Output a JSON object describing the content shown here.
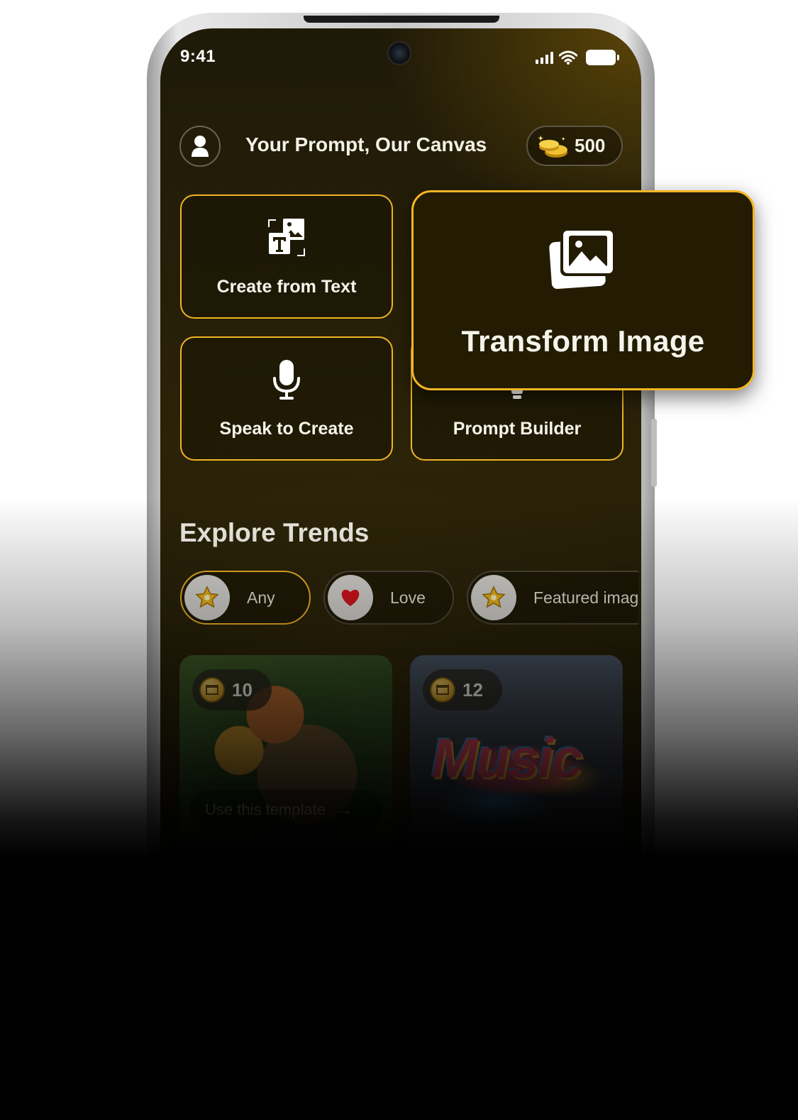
{
  "status_bar": {
    "time": "9:41"
  },
  "header": {
    "title": "Your Prompt, Our Canvas",
    "coins": "500"
  },
  "actions": {
    "create_from_text": "Create from Text",
    "transform_image": "Transform Image",
    "speak_to_create": "Speak to Create",
    "prompt_builder": "Prompt Builder"
  },
  "explore": {
    "title": "Explore Trends",
    "chips": [
      {
        "label": "Any",
        "icon": "star-badge-icon",
        "active": true
      },
      {
        "label": "Love",
        "icon": "heart-icon",
        "active": false
      },
      {
        "label": "Featured image",
        "icon": "star-badge-icon",
        "active": false
      }
    ],
    "templates": [
      {
        "cost": "10",
        "image": "jungle-cartoon-animals",
        "action": "Use this template"
      },
      {
        "cost": "12",
        "image": "music-graffiti-street",
        "art_text": "Music"
      }
    ]
  },
  "colors": {
    "accent": "#F0B424",
    "background": "#1F1A08",
    "text": "#F4F1E6"
  }
}
